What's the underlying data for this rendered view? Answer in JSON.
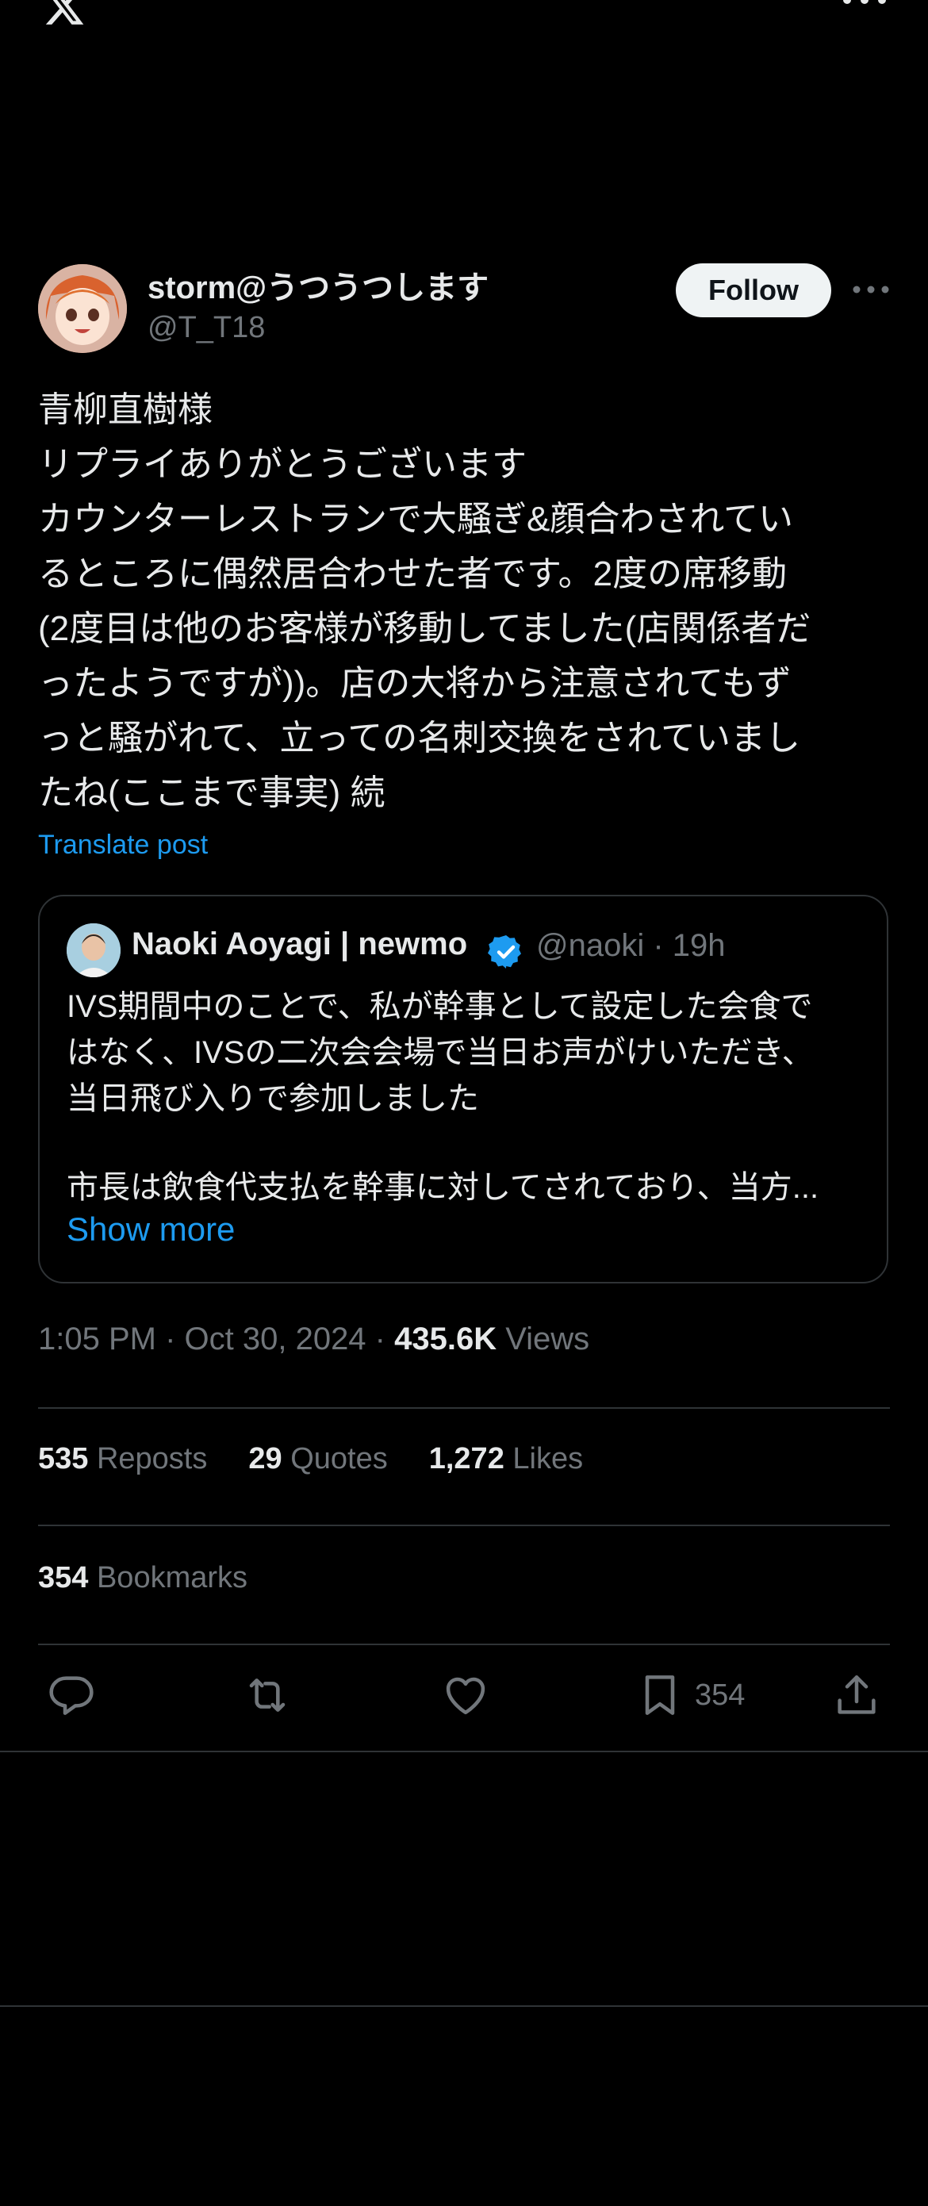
{
  "header": {
    "logo_icon": "x-logo-icon",
    "more_icon": "more-horizontal-icon"
  },
  "author": {
    "display_name": "storm@うつうつします",
    "handle": "@T_T18",
    "follow_label": "Follow",
    "more_icon": "more-horizontal-icon"
  },
  "post": {
    "text": "青柳直樹様\nリプライありがとうございます\nカウンターレストランで大騒ぎ&顔合わされてい\nるところに偶然居合わせた者です。2度の席移動\n(2度目は他のお客様が移動してました(店関係者だ\nったようですが))。店の大将から注意されてもず\nっと騒がれて、立っての名刺交換をされていまし\nたね(ここまで事実) 続",
    "translate_label": "Translate post"
  },
  "quote": {
    "name": "Naoki Aoyagi | newmo",
    "handle_time": "@naoki · 19h",
    "text": "IVS期間中のことで、私が幹事として設定した会食で\nはなく、IVSの二次会会場で当日お声がけいただき、\n当日飛び入りで参加しました",
    "text_last": "市長は飲食代支払を幹事に対してされており、当方...",
    "show_more": "Show more",
    "verified_icon": "verified-badge-icon"
  },
  "meta": {
    "time_date": "1:05 PM · Oct 30, 2024 · ",
    "views_count": "435.6K",
    "views_label": " Views"
  },
  "stats": {
    "reposts_count": "535",
    "reposts_label": " Reposts",
    "quotes_count": "29",
    "quotes_label": " Quotes",
    "likes_count": "1,272",
    "likes_label": " Likes",
    "bookmarks_count": "354",
    "bookmarks_label": " Bookmarks"
  },
  "actions": {
    "reply_icon": "reply-icon",
    "repost_icon": "repost-icon",
    "like_icon": "heart-icon",
    "bookmark_icon": "bookmark-icon",
    "bookmark_count": "354",
    "share_icon": "share-icon"
  },
  "colors": {
    "background": "#000000",
    "text": "#e7e9ea",
    "muted": "#71767b",
    "link": "#1d9bf0",
    "divider": "#2f3336",
    "follow_bg": "#eff3f4"
  }
}
